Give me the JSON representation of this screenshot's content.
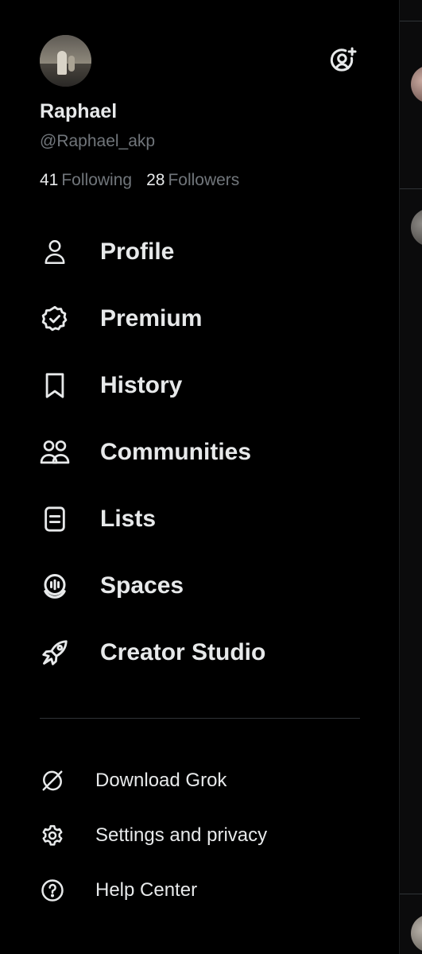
{
  "profile": {
    "display_name": "Raphael",
    "handle": "@Raphael_akp",
    "following_count": "41",
    "following_label": "Following",
    "followers_count": "28",
    "followers_label": "Followers"
  },
  "header": {
    "add_account_icon": "add-account-icon"
  },
  "nav": {
    "items": [
      {
        "label": "Profile",
        "icon": "person-icon"
      },
      {
        "label": "Premium",
        "icon": "verified-badge-icon"
      },
      {
        "label": "History",
        "icon": "bookmark-icon"
      },
      {
        "label": "Communities",
        "icon": "communities-icon"
      },
      {
        "label": "Lists",
        "icon": "list-icon"
      },
      {
        "label": "Spaces",
        "icon": "spaces-icon"
      },
      {
        "label": "Creator Studio",
        "icon": "rocket-icon"
      }
    ]
  },
  "secondary": {
    "items": [
      {
        "label": "Download Grok",
        "icon": "grok-icon"
      },
      {
        "label": "Settings and privacy",
        "icon": "gear-icon"
      },
      {
        "label": "Help Center",
        "icon": "help-icon"
      }
    ]
  },
  "colors": {
    "background": "#000000",
    "text_primary": "#e7e9ea",
    "text_secondary": "#71767b",
    "divider": "#2f3336"
  }
}
